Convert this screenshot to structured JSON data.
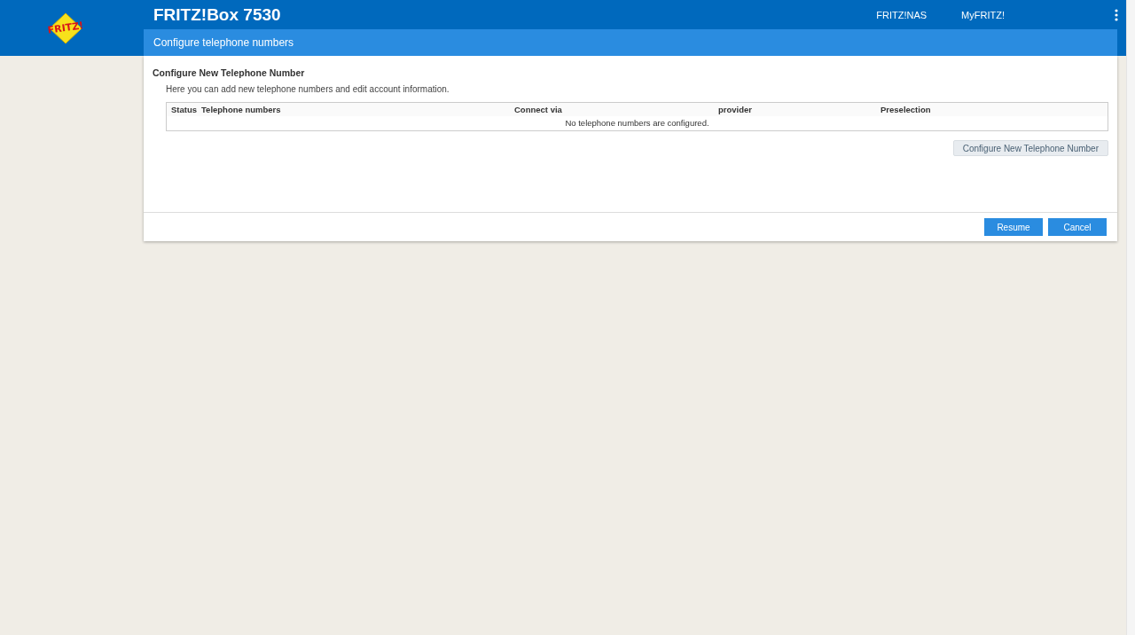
{
  "logo": {
    "text": "FRITZ!"
  },
  "header": {
    "title": "FRITZ!Box 7530",
    "links": [
      "FRITZ!NAS",
      "MyFRITZ!"
    ]
  },
  "page_title": "Configure telephone numbers",
  "section": {
    "heading": "Configure New Telephone Number",
    "description": "Here you can add new telephone numbers and edit account information."
  },
  "table": {
    "columns": [
      "Status",
      "Telephone numbers",
      "Connect via",
      "provider",
      "Preselection"
    ],
    "empty_message": "No telephone numbers are configured."
  },
  "add_button": "Configure New Telephone Number",
  "footer_buttons": [
    "Resume",
    "Cancel"
  ]
}
